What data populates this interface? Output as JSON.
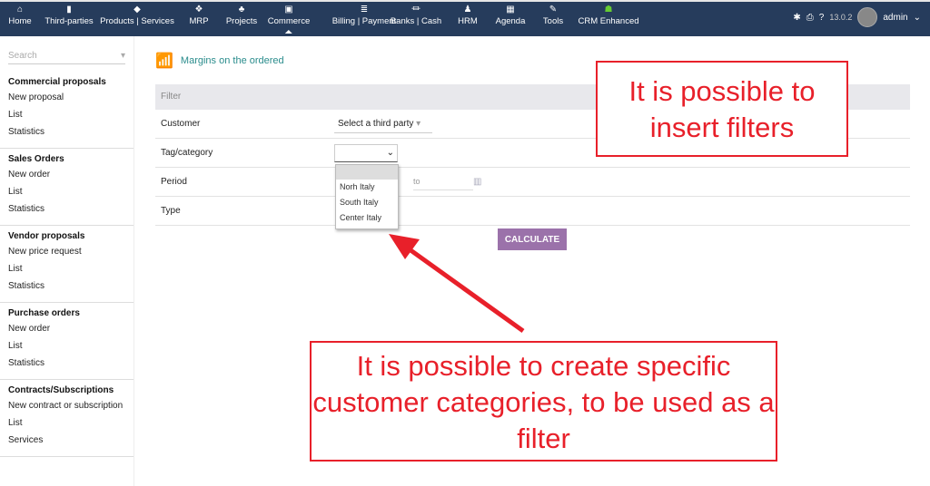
{
  "topnav": [
    {
      "label": "Home",
      "icon": "home-icon",
      "glyph": "⌂"
    },
    {
      "label": "Third-parties",
      "icon": "building-icon",
      "glyph": "▮"
    },
    {
      "label": "Products | Services",
      "icon": "cube-icon",
      "glyph": "◆"
    },
    {
      "label": "MRP",
      "icon": "cubes-icon",
      "glyph": "❖"
    },
    {
      "label": "Projects",
      "icon": "sitemap-icon",
      "glyph": "♣"
    },
    {
      "label": "Commerce",
      "icon": "briefcase-icon",
      "glyph": "▣"
    },
    {
      "label": "Billing | Payment",
      "icon": "coins-icon",
      "glyph": "≣"
    },
    {
      "label": "Banks | Cash",
      "icon": "bank-icon",
      "glyph": "⏛"
    },
    {
      "label": "HRM",
      "icon": "user-tie-icon",
      "glyph": "♟"
    },
    {
      "label": "Agenda",
      "icon": "calendar-icon",
      "glyph": "▦"
    },
    {
      "label": "Tools",
      "icon": "wrench-icon",
      "glyph": "✎"
    },
    {
      "label": "CRM Enhanced",
      "icon": "users-icon",
      "glyph": "☗"
    }
  ],
  "version": "13.0.2",
  "user": "admin",
  "sidebar": {
    "search_placeholder": "Search",
    "groups": [
      {
        "title": "Commercial proposals",
        "items": [
          "New proposal",
          "List",
          "Statistics"
        ]
      },
      {
        "title": "Sales Orders",
        "items": [
          "New order",
          "List",
          "Statistics"
        ]
      },
      {
        "title": "Vendor proposals",
        "items": [
          "New price request",
          "List",
          "Statistics"
        ]
      },
      {
        "title": "Purchase orders",
        "items": [
          "New order",
          "List",
          "Statistics"
        ]
      },
      {
        "title": "Contracts/Subscriptions",
        "items": [
          "New contract or subscription",
          "List",
          "Services"
        ]
      }
    ]
  },
  "main": {
    "title": "Margins on the ordered",
    "filter_header": "Filter",
    "rows": {
      "customer": "Customer",
      "customer_value": "Select a third party",
      "tag": "Tag/category",
      "period": "Period",
      "period_to": "to",
      "type": "Type"
    },
    "dropdown_options": [
      "Norh Italy",
      "South Italy",
      "Center Italy"
    ],
    "calculate": "CALCULATE"
  },
  "annotations": {
    "top": "It is possible to insert filters",
    "bottom": "It is possible to create specific customer categories, to be used as a filter"
  },
  "colors": {
    "topbar": "#263c5c",
    "accent": "#9b72aa",
    "annotation": "#e8202a"
  }
}
